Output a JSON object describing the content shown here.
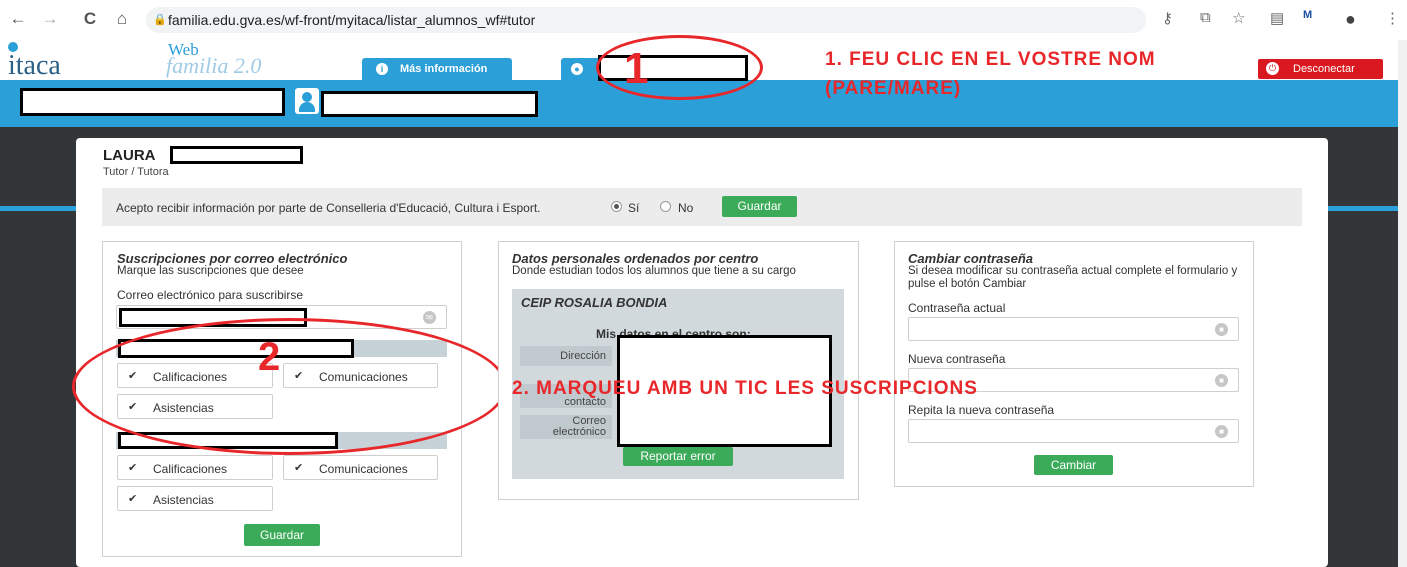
{
  "browser": {
    "url": "familia.edu.gva.es/wf-front/myitaca/listar_alumnos_wf#tutor",
    "nav": {
      "back": "←",
      "forward": "→",
      "reload": "C",
      "home": "⌂"
    }
  },
  "header": {
    "logo_text": "itaca",
    "web_label": "Web",
    "familia_label": "familia 2.0",
    "info_button": "Más información",
    "logout_button": "Desconectar"
  },
  "annotations": {
    "step1_number": "1",
    "step1_text": "1. FEU CLIC EN EL VOSTRE NOM",
    "step1_text_b": "(PARE/MARE)",
    "step2_number": "2",
    "step2_text": "2. MARQUEU AMB UN TIC LES SUSCRIPCIONS"
  },
  "user": {
    "name": "LAURA",
    "role": "Tutor / Tutora"
  },
  "consent": {
    "text": "Acepto recibir información por parte de Conselleria d'Educació, Cultura i Esport.",
    "option_yes": "Sí",
    "option_no": "No",
    "selected": "Sí",
    "save_label": "Guardar"
  },
  "subscriptions": {
    "title": "Suscripciones por correo electrónico",
    "subtitle": "Marque las suscripciones que desee",
    "email_label": "Correo electrónico para suscribirse",
    "students": [
      {
        "options": [
          {
            "label": "Calificaciones",
            "checked": true
          },
          {
            "label": "Comunicaciones",
            "checked": true
          },
          {
            "label": "Asistencias",
            "checked": true
          }
        ]
      },
      {
        "options": [
          {
            "label": "Calificaciones",
            "checked": true
          },
          {
            "label": "Comunicaciones",
            "checked": true
          },
          {
            "label": "Asistencias",
            "checked": true
          }
        ]
      }
    ],
    "save_label": "Guardar"
  },
  "personal_data": {
    "title": "Datos personales ordenados por centro",
    "subtitle": "Donde estudian todos los alumnos que tiene a su cargo",
    "school": "CEIP ROSALIA BONDIA",
    "my_data_label": "Mis datos en el centro son:",
    "fields": [
      "Dirección",
      "contacto",
      "Correo electrónico"
    ],
    "report_label": "Reportar error"
  },
  "password": {
    "title": "Cambiar contraseña",
    "subtitle": "Si desea modificar su contraseña actual complete el formulario y pulse el botón Cambiar",
    "current_label": "Contraseña actual",
    "new_label": "Nueva contraseña",
    "repeat_label": "Repita la nueva contraseña",
    "submit_label": "Cambiar"
  }
}
